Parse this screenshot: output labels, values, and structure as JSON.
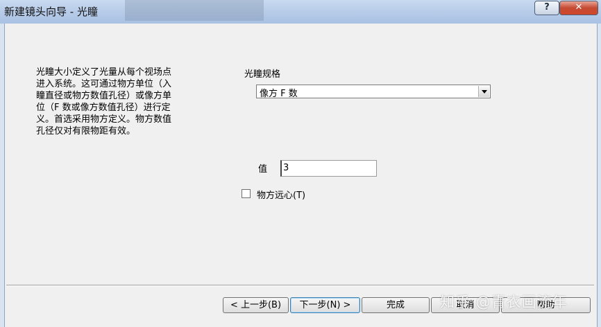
{
  "window": {
    "title": "新建镜头向导 - 光瞳",
    "help_button": "?",
    "close_button": "✕"
  },
  "page": {
    "description": "光瞳大小定义了光量从每个视场点\n进入系统。这可通过物方单位（入\n瞳直径或物方数值孔径）或像方单\n位（F 数或像方数值孔径）进行定\n义。首选采用物方定义。物方数值\n孔径仅对有限物距有效。",
    "spec_label": "光瞳规格",
    "spec_selected": "像方 F 数",
    "value_label": "值",
    "value": "3",
    "telecentric_label": "物方远心(T)"
  },
  "buttons": {
    "back": "< 上一步(B)",
    "next": "下一步(N) >",
    "finish": "完成",
    "cancel": "取消",
    "help": "帮助"
  },
  "watermark": "知乎 @青衣画流年"
}
